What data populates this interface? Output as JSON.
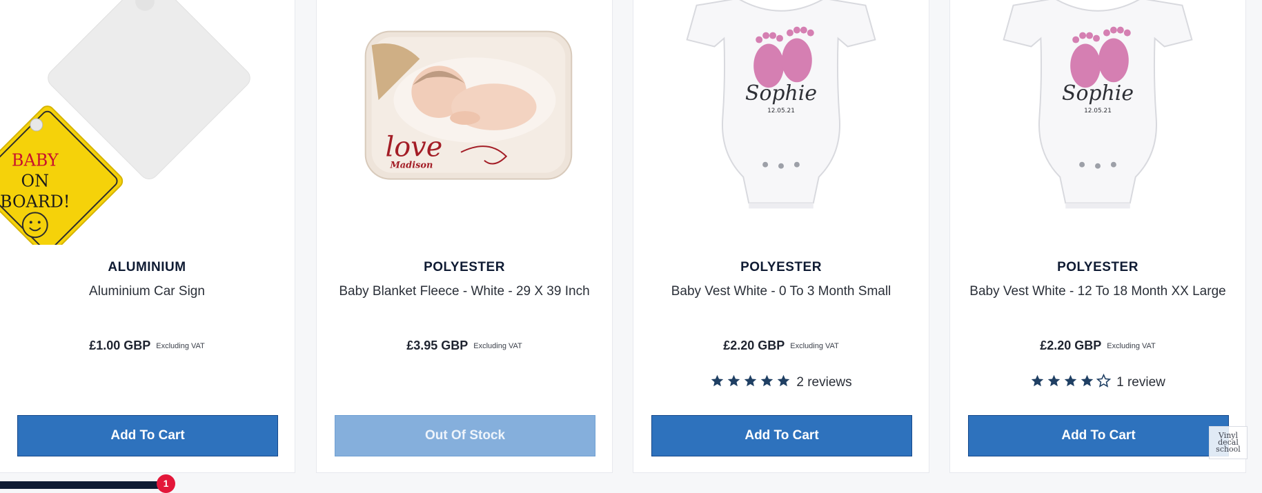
{
  "currency_note": "Excluding VAT",
  "products": [
    {
      "material": "ALUMINIUM",
      "title": "Aluminium Car Sign",
      "price": "£1.00 GBP",
      "rating": null,
      "review_label": "",
      "button_label": "Add To Cart",
      "button_state": "enabled",
      "image_icon": "car-sign-image",
      "image_text": [
        "BABY",
        "ON",
        "BOARD!"
      ]
    },
    {
      "material": "POLYESTER",
      "title": "Baby Blanket Fleece - White - 29 X 39 Inch",
      "price": "£3.95 GBP",
      "rating": null,
      "review_label": "",
      "button_label": "Out Of Stock",
      "button_state": "disabled",
      "image_icon": "baby-blanket-image",
      "image_text": [
        "love",
        "Madison"
      ]
    },
    {
      "material": "POLYESTER",
      "title": "Baby Vest White - 0 To 3 Month Small",
      "price": "£2.20 GBP",
      "rating": 5,
      "review_label": "2 reviews",
      "button_label": "Add To Cart",
      "button_state": "enabled",
      "image_icon": "baby-vest-image",
      "image_text": [
        "Sophie",
        "12.05.21"
      ]
    },
    {
      "material": "POLYESTER",
      "title": "Baby Vest White - 12 To 18 Month XX Large",
      "price": "£2.20 GBP",
      "rating": 4,
      "review_label": "1 review",
      "button_label": "Add To Cart",
      "button_state": "enabled",
      "image_icon": "baby-vest-image",
      "image_text": [
        "Sophie",
        "12.05.21"
      ]
    }
  ],
  "cart_badge_count": "1",
  "watermark_text": [
    "Vinyl",
    "decal",
    "school"
  ],
  "colors": {
    "primary_button": "#2e72bd",
    "disabled_button": "#85afdc",
    "star": "#1f3f63",
    "badge": "#e3173a"
  }
}
